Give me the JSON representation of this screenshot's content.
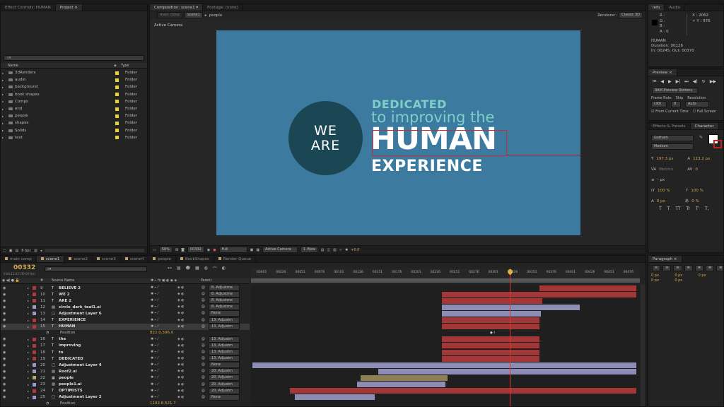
{
  "project": {
    "tabs": [
      "Effect Controls: HUMAN",
      "Project"
    ],
    "col_name": "Name",
    "col_type": "Type",
    "items": [
      {
        "name": "3dRenders",
        "type": "Folder"
      },
      {
        "name": "audio",
        "type": "Folder"
      },
      {
        "name": "background",
        "type": "Folder"
      },
      {
        "name": "book shapes",
        "type": "Folder"
      },
      {
        "name": "Comps",
        "type": "Folder"
      },
      {
        "name": "end",
        "type": "Folder"
      },
      {
        "name": "people",
        "type": "Folder"
      },
      {
        "name": "shapes",
        "type": "Folder"
      },
      {
        "name": "Solids",
        "type": "Folder"
      },
      {
        "name": "text",
        "type": "Folder"
      }
    ],
    "bpc": "8 bpc"
  },
  "composition": {
    "tabs": [
      "Composition: scene1",
      "Footage: (none)"
    ],
    "breadcrumb": [
      "main comp",
      "scene1",
      "people"
    ],
    "renderer_label": "Renderer:",
    "renderer_value": "Classic 3D",
    "active_camera": "Active Camera",
    "zoom": "50%",
    "timecode": "00332",
    "resolution": "Full",
    "view": "Active Camera",
    "views": "1 View",
    "exposure": "+0.0"
  },
  "artwork": {
    "we": "WE",
    "are": "ARE",
    "dedicated": "DEDICATED",
    "improving": "to improving the",
    "human": "HUMAN",
    "experience": "EXPERIENCE"
  },
  "info": {
    "tabs": [
      "Info",
      "Audio"
    ],
    "r": "R :",
    "g": "G :",
    "b": "B :",
    "a": "A : 0",
    "x": "X : 2062",
    "y": "+ Y : 976",
    "layer_name": "HUMAN",
    "duration": "Duration: 00126",
    "in_out": "In: 00245, Out: 00370"
  },
  "preview": {
    "tab": "Preview",
    "ram_options": "RAM Preview Options",
    "frame_rate_label": "Frame Rate",
    "skip_label": "Skip",
    "resolution_label": "Resolution",
    "frame_rate": "(30)",
    "skip": "0",
    "resolution": "Auto",
    "from_current": "From Current Time",
    "full_screen": "Full Screen"
  },
  "character": {
    "tabs": [
      "Effects & Presets",
      "Character"
    ],
    "font": "Gotham",
    "style": "Medium",
    "size": "197.3 px",
    "leading": "113.2 px",
    "kerning": "Metrics",
    "tracking": "0",
    "stroke": "- px",
    "vscale": "100 %",
    "hscale": "100 %",
    "baseline": "0 px",
    "tsume": "0 %",
    "styles": [
      "T",
      "T",
      "TT",
      "Tr",
      "T'",
      "T,"
    ]
  },
  "paragraph": {
    "tab": "Paragraph",
    "indent1": "0 px",
    "indent2": "0 px",
    "indent3": "0 px",
    "space1": "0 px",
    "space2": "0 px"
  },
  "timeline": {
    "tabs": [
      "main comp",
      "scene1",
      "scene2",
      "scene3",
      "scene4",
      "people",
      "BookShapes",
      "Render Queue"
    ],
    "timecode": "00332",
    "timecode_sub": "0:00:11:02 (30.00 fps)",
    "col_num": "#",
    "col_source": "Source Name",
    "col_parent": "Parent",
    "ruler": [
      "00001",
      "00026",
      "00051",
      "00076",
      "00101",
      "00126",
      "00151",
      "00176",
      "00201",
      "00226",
      "00251",
      "00276",
      "00301",
      "00326",
      "00351",
      "00376",
      "00401",
      "00426",
      "00451",
      "00476"
    ],
    "layers": [
      {
        "num": "9",
        "name": "BELIEVE 2",
        "color": "#b03a3a",
        "parent": "8. Adjustme",
        "kind": "text"
      },
      {
        "num": "10",
        "name": "WE 2",
        "color": "#b03a3a",
        "parent": "8. Adjustme",
        "kind": "text"
      },
      {
        "num": "11",
        "name": "ARE 2",
        "color": "#b03a3a",
        "parent": "8. Adjustme",
        "kind": "text"
      },
      {
        "num": "12",
        "name": "circle_dark_teal1.ai",
        "color": "#9a9ac8",
        "parent": "8. Adjustme",
        "kind": "ai"
      },
      {
        "num": "13",
        "name": "Adjustment Layer 6",
        "color": "#9a9ac8",
        "parent": "None",
        "kind": "solid"
      },
      {
        "num": "14",
        "name": "EXPERIENCE",
        "color": "#b03a3a",
        "parent": "13. Adjustm",
        "kind": "text"
      },
      {
        "num": "15",
        "name": "HUMAN",
        "color": "#b03a3a",
        "parent": "13. Adjustm",
        "kind": "text",
        "selected": true
      },
      {
        "prop": true,
        "name": "Position",
        "value": "822.0,596.0"
      },
      {
        "num": "16",
        "name": "the",
        "color": "#b03a3a",
        "parent": "13. Adjustm",
        "kind": "text"
      },
      {
        "num": "17",
        "name": "improving",
        "color": "#b03a3a",
        "parent": "13. Adjustm",
        "kind": "text"
      },
      {
        "num": "18",
        "name": "to",
        "color": "#b03a3a",
        "parent": "13. Adjustm",
        "kind": "text"
      },
      {
        "num": "19",
        "name": "DEDICATED",
        "color": "#b03a3a",
        "parent": "13. Adjustm",
        "kind": "text"
      },
      {
        "num": "20",
        "name": "Adjustment Layer 4",
        "color": "#9a9ac8",
        "parent": "None",
        "kind": "solid"
      },
      {
        "num": "21",
        "name": "Roof2.ai",
        "color": "#9a9ac8",
        "parent": "20. Adjustm",
        "kind": "ai"
      },
      {
        "num": "22",
        "name": "people",
        "color": "#b8a46a",
        "parent": "20. Adjustm",
        "kind": "comp"
      },
      {
        "num": "23",
        "name": "people1.ai",
        "color": "#9a9ac8",
        "parent": "20. Adjustm",
        "kind": "ai"
      },
      {
        "num": "24",
        "name": "OPTIMISTS",
        "color": "#b03a3a",
        "parent": "20. Adjustm",
        "kind": "text"
      },
      {
        "num": "25",
        "name": "Adjustment Layer 2",
        "color": "#9a9ac8",
        "parent": "None",
        "kind": "solid"
      },
      {
        "prop": true,
        "name": "Position",
        "value": "1102.8,521.7"
      }
    ]
  }
}
